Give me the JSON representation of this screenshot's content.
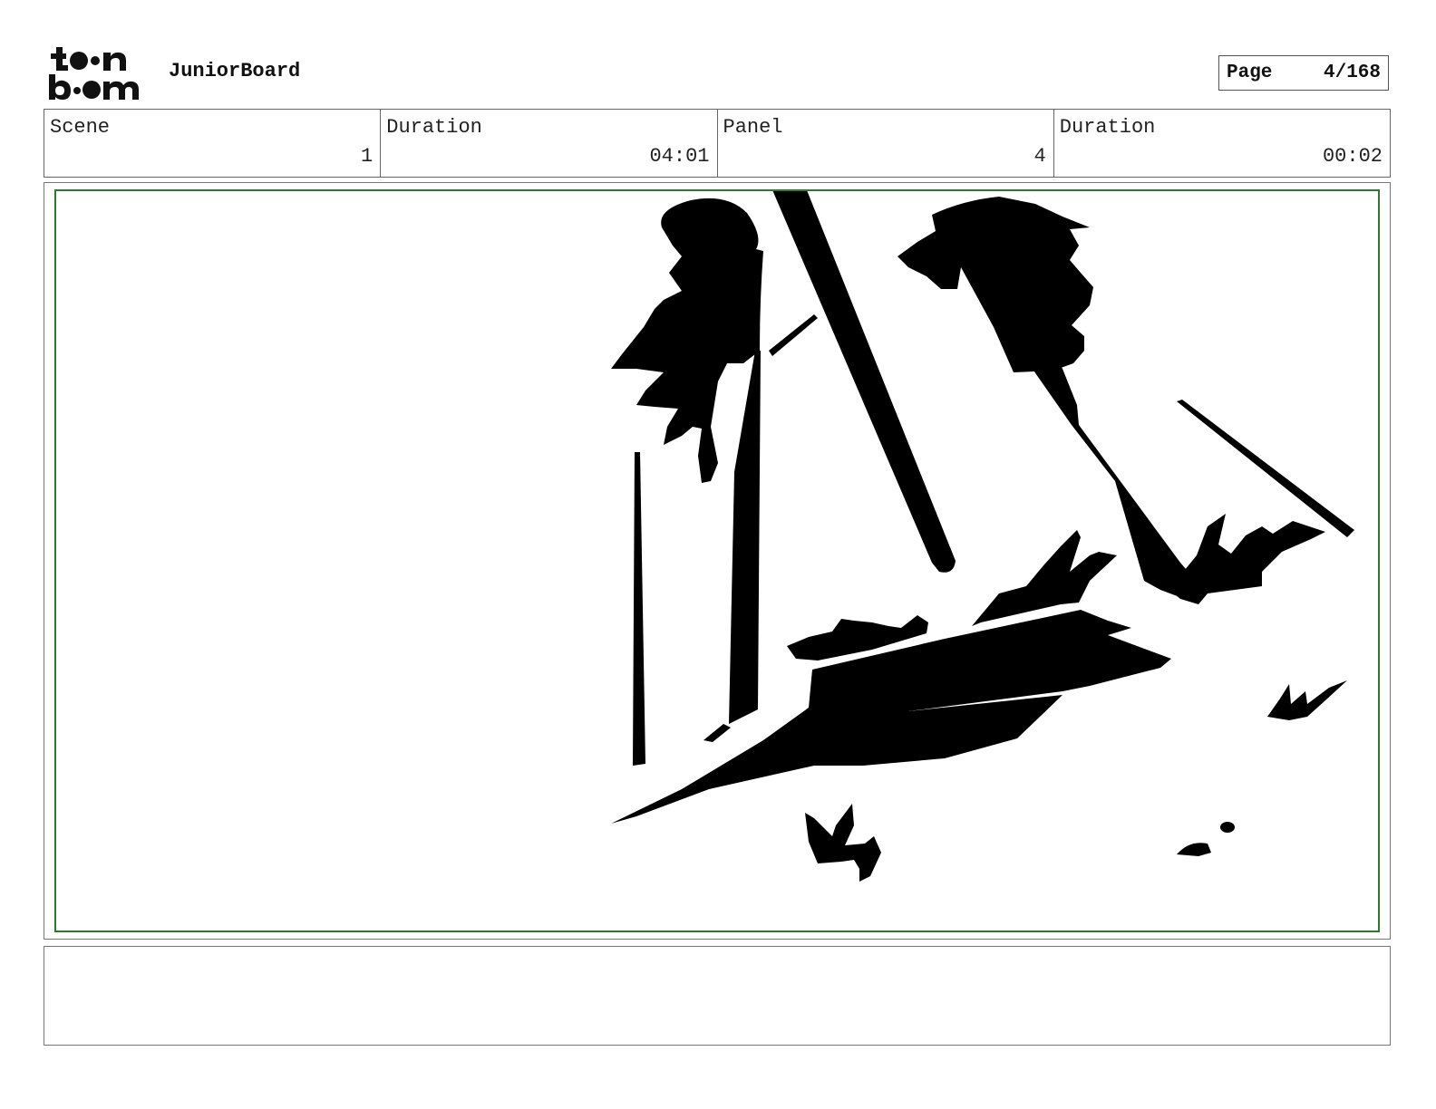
{
  "header": {
    "logo_icon": "toonboom-logo-icon",
    "project_title": "JuniorBoard",
    "page_label": "Page",
    "page_number": "4/168"
  },
  "info": {
    "scene_label": "Scene",
    "scene_value": "1",
    "scene_duration_label": "Duration",
    "scene_duration_value": "04:01",
    "panel_label": "Panel",
    "panel_value": "4",
    "panel_duration_label": "Duration",
    "panel_duration_value": "00:02"
  },
  "colors": {
    "safe_area_border": "#2d7a2d",
    "ink": "#000000"
  },
  "notes": {
    "text": ""
  }
}
